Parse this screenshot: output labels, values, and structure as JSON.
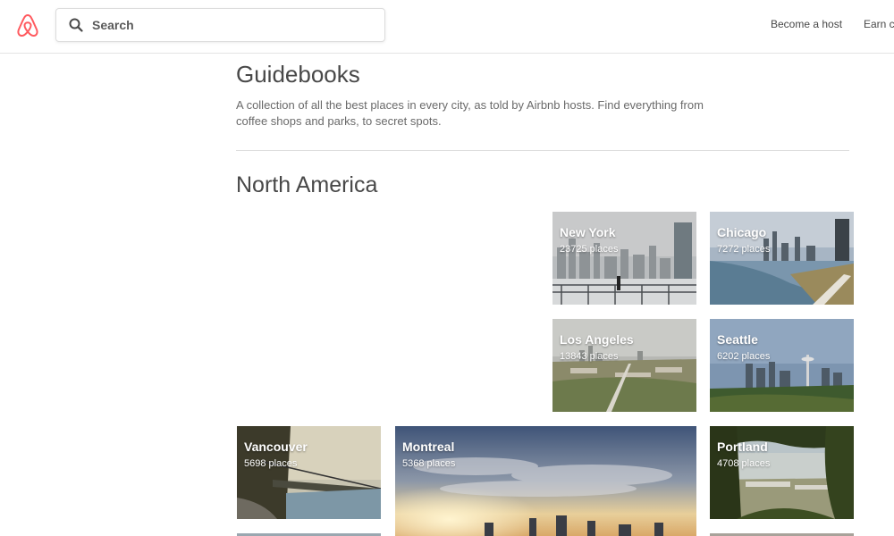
{
  "header": {
    "logo_icon": "airbnb-logo-icon",
    "search_placeholder": "Search",
    "search_value": "",
    "nav": [
      "Become a host",
      "Earn cr"
    ]
  },
  "main": {
    "title": "Guidebooks",
    "description": "A collection of all the best places in every city, as told by Airbnb hosts. Find everything from coffee shops and parks, to secret spots.",
    "section_title": "North America",
    "cities": [
      {
        "name": "New York",
        "places": "23725 places"
      },
      {
        "name": "Chicago",
        "places": "7272 places"
      },
      {
        "name": "Los Angeles",
        "places": "13843 places"
      },
      {
        "name": "Seattle",
        "places": "6202 places"
      },
      {
        "name": "Vancouver",
        "places": "5698 places"
      },
      {
        "name": "Montreal",
        "places": "5368 places"
      },
      {
        "name": "Portland",
        "places": "4708 places"
      }
    ]
  },
  "colors": {
    "brand": "#FF5A5F",
    "text": "#484848",
    "muted": "#6a6a6a"
  }
}
